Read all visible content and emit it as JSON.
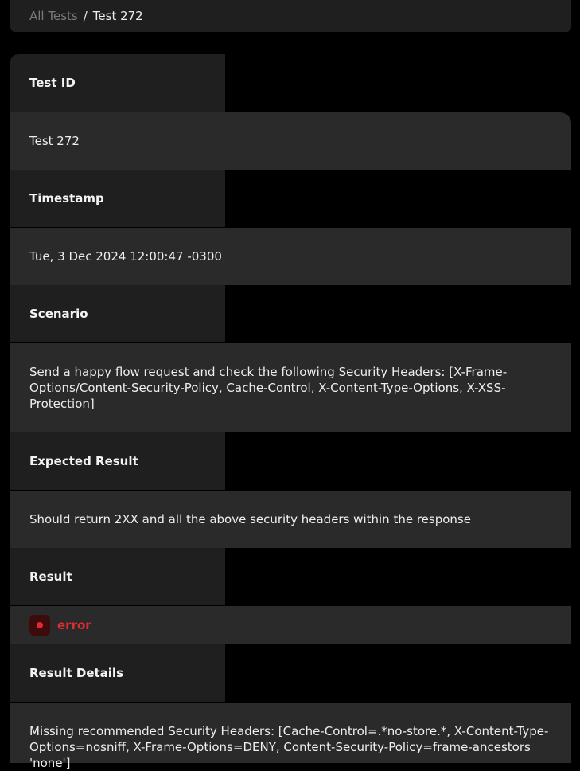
{
  "breadcrumb": {
    "root": "All Tests",
    "separator": "/",
    "current": "Test 272"
  },
  "details": {
    "test_id": {
      "label": "Test ID",
      "value": "Test 272"
    },
    "timestamp": {
      "label": "Timestamp",
      "value": "Tue, 3 Dec 2024 12:00:47 -0300"
    },
    "scenario": {
      "label": "Scenario",
      "value": "Send a happy flow request and check the following Security Headers: [X-Frame-Options/Content-Security-Policy, Cache-Control, X-Content-Type-Options, X-XSS-Protection]"
    },
    "expected_result": {
      "label": "Expected Result",
      "value": "Should return 2XX and all the above security headers within the response"
    },
    "result": {
      "label": "Result",
      "value": "error",
      "status_color": "#e02b33",
      "icon": "error-dot-icon"
    },
    "result_details": {
      "label": "Result Details",
      "value": "Missing recommended Security Headers: [Cache-Control=.*no-store.*, X-Content-Type-Options=nosniff, X-Frame-Options=DENY, Content-Security-Policy=frame-ancestors 'none']"
    }
  }
}
